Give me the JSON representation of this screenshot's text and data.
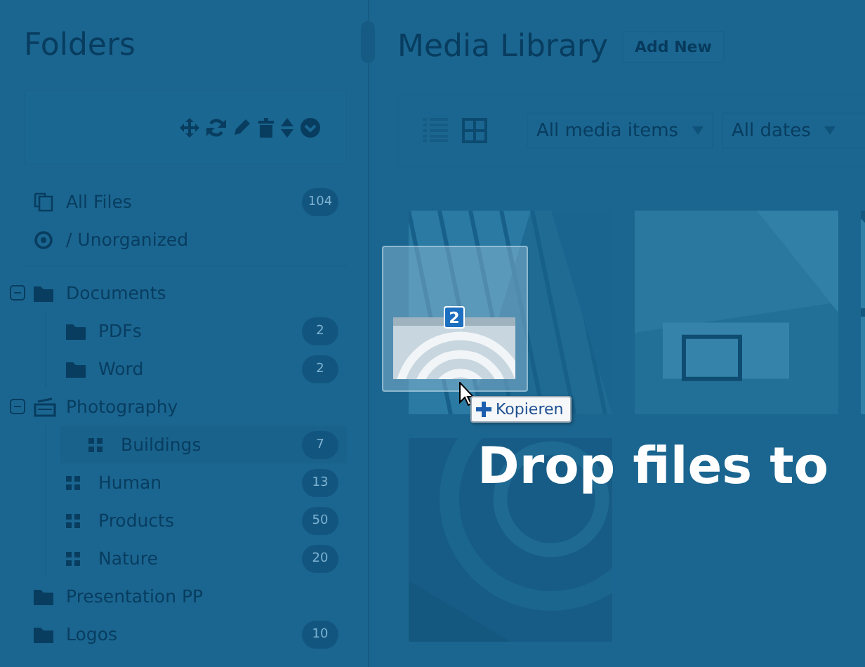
{
  "sidebar": {
    "title": "Folders",
    "special_items": [
      {
        "kind": "all",
        "label": "All Files",
        "count": "104",
        "selected": false
      },
      {
        "kind": "unorganized",
        "label": "/ Unorganized",
        "selected": false
      }
    ],
    "folders": [
      {
        "kind": "folder",
        "label": "Documents",
        "expanded": true,
        "selected": false,
        "children": [
          {
            "kind": "folder",
            "label": "PDFs",
            "count": "2",
            "selected": false
          },
          {
            "kind": "folder",
            "label": "Word",
            "count": "2",
            "selected": false
          }
        ]
      },
      {
        "kind": "gallery",
        "label": "Photography",
        "expanded": true,
        "selected": false,
        "children": [
          {
            "kind": "collection",
            "label": "Buildings",
            "count": "7",
            "selected": true
          },
          {
            "kind": "collection",
            "label": "Human",
            "count": "13",
            "selected": false
          },
          {
            "kind": "collection",
            "label": "Products",
            "count": "50",
            "selected": false
          },
          {
            "kind": "collection",
            "label": "Nature",
            "count": "20",
            "selected": false
          }
        ]
      },
      {
        "kind": "folder",
        "label": "Presentation PP",
        "selected": false
      },
      {
        "kind": "folder",
        "label": "Logos",
        "count": "10",
        "selected": false
      }
    ]
  },
  "main": {
    "title": "Media Library",
    "add_button": "Add New",
    "view_modes": [
      {
        "kind": "list",
        "selected": false
      },
      {
        "kind": "grid",
        "selected": true
      }
    ],
    "filters": [
      "All media items",
      "All dates"
    ],
    "drop_message": "Drop files to"
  },
  "drag": {
    "count": "2",
    "tooltip": "Kopieren"
  }
}
